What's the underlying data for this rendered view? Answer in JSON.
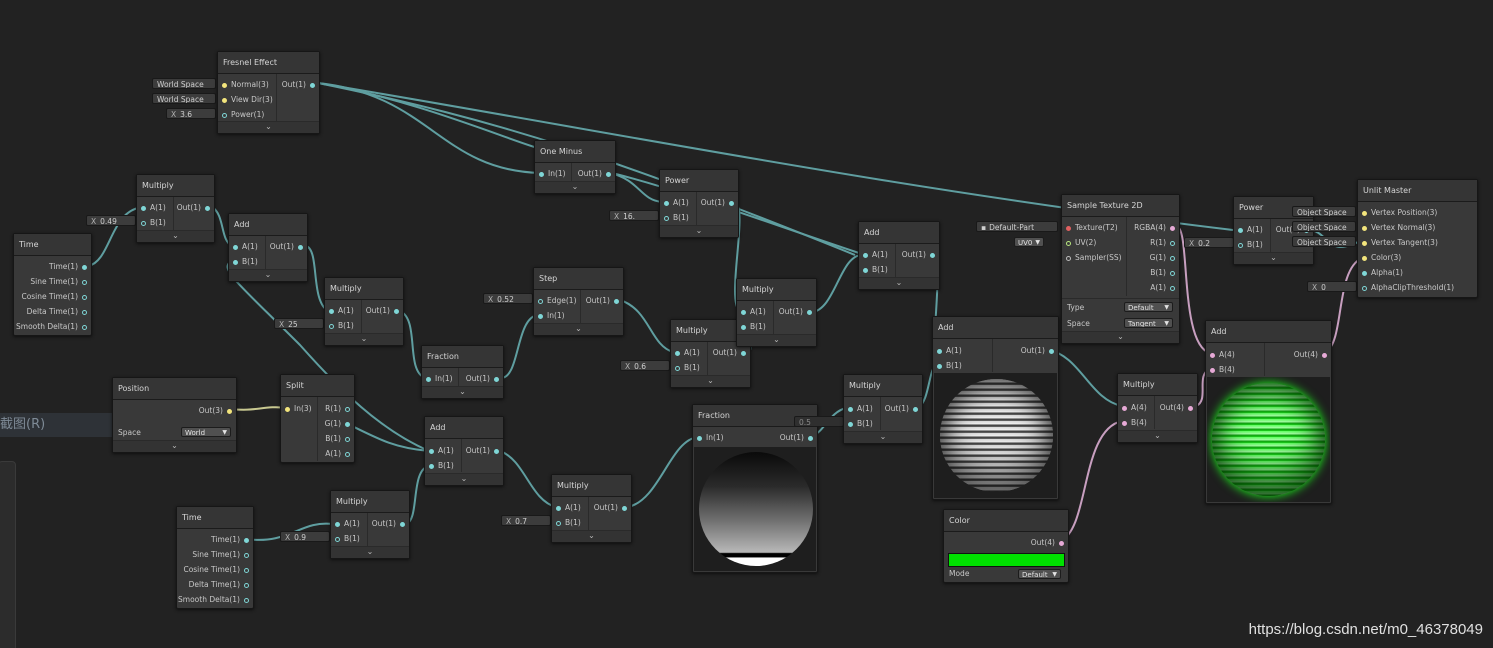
{
  "watermark": "https://blog.csdn.net/m0_46378049",
  "context_menu_fragment": "截图(R)",
  "colors": {
    "wire_default": "#5f9ea0",
    "wire_color": "#c89fc0",
    "wire_vec3": "#c8c890",
    "port_cyan": "#7fd6d6",
    "port_pink": "#e6a9d6",
    "port_yellow": "#f2e47c",
    "color_swatch": "#00e000"
  },
  "nodes": {
    "fresnel": {
      "title": "Fresnel Effect",
      "in1": "Normal(3)",
      "in2": "View Dir(3)",
      "in3": "Power(1)",
      "out": "Out(1)",
      "chip1": "World Space",
      "chip2": "World Space",
      "chip3_label": "X",
      "chip3_value": "3.6"
    },
    "multiply1": {
      "title": "Multiply",
      "inA": "A(1)",
      "inB": "B(1)",
      "out": "Out(1)",
      "chip_label": "X",
      "chip_value": "0.49"
    },
    "time1": {
      "title": "Time",
      "out1": "Time(1)",
      "out2": "Sine Time(1)",
      "out3": "Cosine Time(1)",
      "out4": "Delta Time(1)",
      "out5": "Smooth Delta(1)"
    },
    "add1": {
      "title": "Add",
      "inA": "A(1)",
      "inB": "B(1)",
      "out": "Out(1)"
    },
    "multiply2": {
      "title": "Multiply",
      "inA": "A(1)",
      "inB": "B(1)",
      "out": "Out(1)",
      "chip_label": "X",
      "chip_value": "25"
    },
    "fraction1": {
      "title": "Fraction",
      "in": "In(1)",
      "out": "Out(1)"
    },
    "oneminus": {
      "title": "One Minus",
      "in": "In(1)",
      "out": "Out(1)"
    },
    "power1": {
      "title": "Power",
      "inA": "A(1)",
      "inB": "B(1)",
      "out": "Out(1)",
      "chip_label": "X",
      "chip_value": "16."
    },
    "step": {
      "title": "Step",
      "in1": "Edge(1)",
      "in2": "In(1)",
      "out": "Out(1)",
      "chip_label": "X",
      "chip_value": "0.52"
    },
    "multiply3": {
      "title": "Multiply",
      "inA": "A(1)",
      "inB": "B(1)",
      "out": "Out(1)",
      "chip_label": "X",
      "chip_value": "0.6"
    },
    "multiply4": {
      "title": "Multiply",
      "inA": "A(1)",
      "inB": "B(1)",
      "out": "Out(1)"
    },
    "add2": {
      "title": "Add",
      "inA": "A(1)",
      "inB": "B(1)",
      "out": "Out(1)"
    },
    "position": {
      "title": "Position",
      "out": "Out(3)",
      "space_label": "Space",
      "space_value": "World"
    },
    "split": {
      "title": "Split",
      "in": "In(3)",
      "out1": "R(1)",
      "out2": "G(1)",
      "out3": "B(1)",
      "out4": "A(1)"
    },
    "add3": {
      "title": "Add",
      "inA": "A(1)",
      "inB": "B(1)",
      "out": "Out(1)"
    },
    "time2": {
      "title": "Time",
      "out1": "Time(1)",
      "out2": "Sine Time(1)",
      "out3": "Cosine Time(1)",
      "out4": "Delta Time(1)",
      "out5": "Smooth Delta(1)"
    },
    "multiply5": {
      "title": "Multiply",
      "inA": "A(1)",
      "inB": "B(1)",
      "out": "Out(1)",
      "chip_label": "X",
      "chip_value": "0.9"
    },
    "multiply6": {
      "title": "Multiply",
      "inA": "A(1)",
      "inB": "B(1)",
      "out": "Out(1)",
      "chip_label": "X",
      "chip_value": "0.7"
    },
    "fraction2": {
      "title": "Fraction",
      "in": "In(1)",
      "out": "Out(1)"
    },
    "multiply7": {
      "title": "Multiply",
      "inA": "A(1)",
      "inB": "B(1)",
      "out": "Out(1)",
      "chip_value": "0.5"
    },
    "add4": {
      "title": "Add",
      "inA": "A(1)",
      "inB": "B(1)",
      "out": "Out(1)"
    },
    "sampletex": {
      "title": "Sample Texture 2D",
      "in1": "Texture(T2)",
      "in2": "UV(2)",
      "in3": "Sampler(SS)",
      "out1": "RGBA(4)",
      "out2": "R(1)",
      "out3": "G(1)",
      "out4": "B(1)",
      "out5": "A(1)",
      "chip_texture": "Default-Part",
      "chip_uv": "UV0",
      "type_label": "Type",
      "type_value": "Default",
      "space_label": "Space",
      "space_value": "Tangent"
    },
    "color": {
      "title": "Color",
      "out": "Out(4)",
      "mode_label": "Mode",
      "mode_value": "Default"
    },
    "multiply8": {
      "title": "Multiply",
      "inA": "A(4)",
      "inB": "B(4)",
      "out": "Out(4)"
    },
    "power2": {
      "title": "Power",
      "inA": "A(1)",
      "inB": "B(1)",
      "out": "Out(1)",
      "chip_label": "X",
      "chip_value": "0.2"
    },
    "add5": {
      "title": "Add",
      "inA": "A(4)",
      "inB": "B(4)",
      "out": "Out(4)"
    },
    "master": {
      "title": "Unlit Master",
      "in1": "Vertex Position(3)",
      "in2": "Vertex Normal(3)",
      "in3": "Vertex Tangent(3)",
      "in4": "Color(3)",
      "in5": "Alpha(1)",
      "in6": "AlphaClipThreshold(1)",
      "chip1": "Object Space",
      "chip2": "Object Space",
      "chip3": "Object Space",
      "chip6_label": "X",
      "chip6_value": "0"
    }
  }
}
